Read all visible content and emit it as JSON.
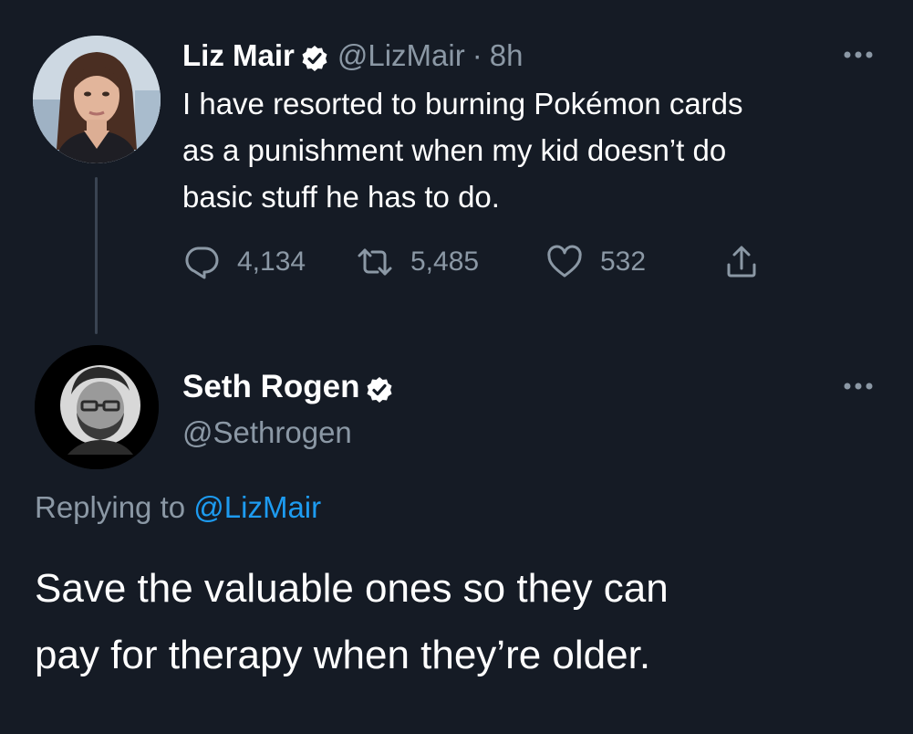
{
  "original_tweet": {
    "display_name": "Liz Mair",
    "handle": "@LizMair",
    "separator": "·",
    "time": "8h",
    "text_lines": [
      "I have resorted to burning Pokémon cards",
      "as a punishment when my kid doesn’t do",
      "basic stuff he has to do."
    ],
    "replies_count": "4,134",
    "retweets_count": "5,485",
    "likes_count": "532",
    "avatar_icon": "profile-photo-woman"
  },
  "reply_tweet": {
    "display_name": "Seth Rogen",
    "handle": "@Sethrogen",
    "replying_prefix": "Replying to",
    "replying_to": "@LizMair",
    "text_lines": [
      "Save the valuable ones so they can",
      "pay for therapy when they’re older."
    ],
    "avatar_icon": "profile-photo-man-bw"
  },
  "colors": {
    "background": "#151b25",
    "text_primary": "#ffffff",
    "text_secondary": "#8b98a5",
    "accent_link": "#1d9bf0",
    "thread_line": "#3a4452"
  },
  "icons": {
    "verified": "verified-badge-icon",
    "more": "more-options-icon",
    "reply": "reply-icon",
    "retweet": "retweet-icon",
    "like": "heart-icon",
    "share": "share-icon"
  }
}
